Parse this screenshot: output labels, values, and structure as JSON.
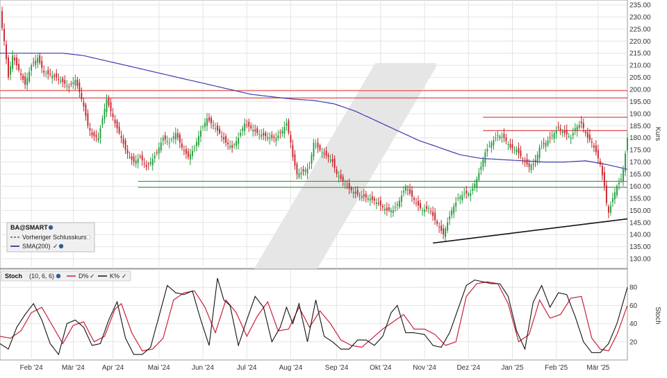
{
  "chart_data": [
    {
      "type": "candlestick",
      "title": "",
      "ylabel": "Kurs",
      "ylim": [
        126,
        237
      ],
      "yticks": [
        130,
        135,
        140,
        145,
        150,
        155,
        160,
        165,
        170,
        175,
        180,
        185,
        190,
        195,
        200,
        205,
        210,
        215,
        220,
        225,
        230,
        235
      ],
      "ytick_labels": [
        "130.00",
        "135.00",
        "140.00",
        "145.00",
        "150.00",
        "155.00",
        "160.00",
        "165.00",
        "170.00",
        "175.00",
        "180.00",
        "185.00",
        "190.00",
        "195.00",
        "200.00",
        "205.00",
        "210.00",
        "215.00",
        "220.00",
        "225.00",
        "230.00",
        "235.00"
      ],
      "month_labels": [
        "Feb '24",
        "Mär '24",
        "Apr '24",
        "Mai '24",
        "Jun '24",
        "Jul '24",
        "Aug '24",
        "Sep '24",
        "Okt '24",
        "Nov '24",
        "Dez '24",
        "Jan '25",
        "Feb '25",
        "Mär '25"
      ],
      "x_range": [
        0,
        300
      ],
      "month_positions": [
        15,
        35,
        54,
        76,
        97,
        118,
        139,
        161,
        182,
        203,
        224,
        245,
        266,
        286
      ],
      "close_anchors": [
        [
          0,
          231
        ],
        [
          2,
          220
        ],
        [
          4,
          205
        ],
        [
          6,
          214
        ],
        [
          9,
          208
        ],
        [
          12,
          202
        ],
        [
          15,
          210
        ],
        [
          18,
          213
        ],
        [
          21,
          207
        ],
        [
          24,
          206
        ],
        [
          27,
          205
        ],
        [
          30,
          203
        ],
        [
          33,
          201
        ],
        [
          36,
          204
        ],
        [
          38,
          199
        ],
        [
          40,
          193
        ],
        [
          42,
          185
        ],
        [
          44,
          181
        ],
        [
          47,
          180
        ],
        [
          49,
          188
        ],
        [
          51,
          196
        ],
        [
          53,
          191
        ],
        [
          55,
          186
        ],
        [
          58,
          180
        ],
        [
          60,
          175
        ],
        [
          62,
          172
        ],
        [
          64,
          170
        ],
        [
          67,
          172
        ],
        [
          70,
          168
        ],
        [
          72,
          170
        ],
        [
          75,
          174
        ],
        [
          78,
          180
        ],
        [
          81,
          178
        ],
        [
          84,
          182
        ],
        [
          87,
          176
        ],
        [
          90,
          172
        ],
        [
          93,
          176
        ],
        [
          96,
          183
        ],
        [
          99,
          188
        ],
        [
          102,
          185
        ],
        [
          105,
          182
        ],
        [
          108,
          178
        ],
        [
          111,
          176
        ],
        [
          114,
          180
        ],
        [
          117,
          186
        ],
        [
          120,
          184
        ],
        [
          123,
          182
        ],
        [
          126,
          181
        ],
        [
          129,
          180
        ],
        [
          132,
          180
        ],
        [
          135,
          183
        ],
        [
          137,
          186
        ],
        [
          139,
          178
        ],
        [
          140,
          172
        ],
        [
          142,
          165
        ],
        [
          145,
          166
        ],
        [
          148,
          168
        ],
        [
          150,
          178
        ],
        [
          152,
          176
        ],
        [
          154,
          174
        ],
        [
          157,
          172
        ],
        [
          159,
          170
        ],
        [
          161,
          165
        ],
        [
          164,
          162
        ],
        [
          167,
          159
        ],
        [
          170,
          157
        ],
        [
          173,
          156
        ],
        [
          176,
          155
        ],
        [
          179,
          154
        ],
        [
          182,
          152
        ],
        [
          185,
          150
        ],
        [
          188,
          150
        ],
        [
          191,
          154
        ],
        [
          194,
          160
        ],
        [
          196,
          157
        ],
        [
          199,
          153
        ],
        [
          202,
          150
        ],
        [
          205,
          151
        ],
        [
          208,
          146
        ],
        [
          210,
          143
        ],
        [
          212,
          140
        ],
        [
          214,
          145
        ],
        [
          216,
          150
        ],
        [
          219,
          155
        ],
        [
          222,
          157
        ],
        [
          225,
          157
        ],
        [
          228,
          163
        ],
        [
          230,
          168
        ],
        [
          232,
          174
        ],
        [
          235,
          178
        ],
        [
          238,
          181
        ],
        [
          241,
          180
        ],
        [
          244,
          176
        ],
        [
          247,
          175
        ],
        [
          250,
          171
        ],
        [
          253,
          168
        ],
        [
          256,
          170
        ],
        [
          258,
          176
        ],
        [
          261,
          178
        ],
        [
          264,
          181
        ],
        [
          267,
          184
        ],
        [
          270,
          182
        ],
        [
          273,
          180
        ],
        [
          275,
          184
        ],
        [
          278,
          186
        ],
        [
          281,
          180
        ],
        [
          283,
          178
        ],
        [
          285,
          174
        ],
        [
          287,
          169
        ],
        [
          289,
          160
        ],
        [
          290,
          153
        ],
        [
          291,
          149
        ],
        [
          293,
          155
        ],
        [
          295,
          160
        ],
        [
          297,
          163
        ],
        [
          298,
          167
        ],
        [
          300,
          180
        ]
      ],
      "sma_anchors": [
        [
          0,
          215
        ],
        [
          8,
          215
        ],
        [
          30,
          215
        ],
        [
          40,
          214
        ],
        [
          50,
          212
        ],
        [
          60,
          210
        ],
        [
          70,
          208
        ],
        [
          80,
          206
        ],
        [
          90,
          204
        ],
        [
          100,
          202
        ],
        [
          110,
          200
        ],
        [
          120,
          198
        ],
        [
          130,
          197
        ],
        [
          140,
          196
        ],
        [
          150,
          195.5
        ],
        [
          160,
          194
        ],
        [
          170,
          191
        ],
        [
          180,
          187
        ],
        [
          190,
          183
        ],
        [
          200,
          179
        ],
        [
          210,
          176
        ],
        [
          220,
          173
        ],
        [
          230,
          171.5
        ],
        [
          240,
          171
        ],
        [
          250,
          170.5
        ],
        [
          260,
          170
        ],
        [
          270,
          170
        ],
        [
          280,
          170.5
        ],
        [
          290,
          169
        ],
        [
          300,
          167
        ]
      ],
      "resistance_lines": [
        199.5,
        196.5
      ],
      "short_resistance_lines": [
        188.5,
        183
      ],
      "support_lines": [
        162,
        159.5
      ],
      "trendline": [
        [
          207,
          136.5
        ],
        [
          300,
          146.5
        ]
      ],
      "legend": {
        "symbol": "BA@SMART",
        "items": [
          {
            "label": "Vorheriger Schlusskurs",
            "color": "#444444",
            "style": "dashed"
          },
          {
            "label": "SMA(200)",
            "color": "#1a1a9c",
            "style": "solid"
          }
        ]
      },
      "colors": {
        "up": "#1f9c3a",
        "down": "#c8202a",
        "sma": "#3b3bb0",
        "resistance": "#e03030",
        "support": "#2aa02a",
        "trend": "#111111"
      }
    },
    {
      "type": "line",
      "title": "Stoch",
      "params": "(10, 6, 6)",
      "ylabel": "Stoch",
      "ylim": [
        0,
        100
      ],
      "yticks": [
        20,
        40,
        60,
        80
      ],
      "series": [
        {
          "name": "D%",
          "color": "#c8203a",
          "anchors": [
            [
              0,
              26
            ],
            [
              5,
              24
            ],
            [
              10,
              32
            ],
            [
              15,
              52
            ],
            [
              20,
              58
            ],
            [
              25,
              38
            ],
            [
              30,
              18
            ],
            [
              35,
              38
            ],
            [
              40,
              42
            ],
            [
              45,
              20
            ],
            [
              50,
              26
            ],
            [
              55,
              56
            ],
            [
              58,
              62
            ],
            [
              63,
              30
            ],
            [
              68,
              10
            ],
            [
              73,
              12
            ],
            [
              78,
              24
            ],
            [
              83,
              66
            ],
            [
              88,
              74
            ],
            [
              93,
              76
            ],
            [
              98,
              58
            ],
            [
              103,
              30
            ],
            [
              108,
              66
            ],
            [
              113,
              52
            ],
            [
              118,
              26
            ],
            [
              123,
              48
            ],
            [
              128,
              64
            ],
            [
              133,
              32
            ],
            [
              138,
              34
            ],
            [
              143,
              58
            ],
            [
              148,
              36
            ],
            [
              153,
              54
            ],
            [
              158,
              40
            ],
            [
              163,
              22
            ],
            [
              168,
              16
            ],
            [
              173,
              14
            ],
            [
              178,
              24
            ],
            [
              183,
              34
            ],
            [
              188,
              42
            ],
            [
              193,
              50
            ],
            [
              198,
              34
            ],
            [
              203,
              34
            ],
            [
              208,
              28
            ],
            [
              213,
              16
            ],
            [
              218,
              20
            ],
            [
              223,
              70
            ],
            [
              228,
              84
            ],
            [
              233,
              86
            ],
            [
              238,
              84
            ],
            [
              243,
              62
            ],
            [
              248,
              20
            ],
            [
              253,
              28
            ],
            [
              258,
              66
            ],
            [
              263,
              46
            ],
            [
              268,
              50
            ],
            [
              273,
              68
            ],
            [
              278,
              70
            ],
            [
              283,
              24
            ],
            [
              287,
              12
            ],
            [
              291,
              10
            ],
            [
              295,
              28
            ],
            [
              300,
              60
            ]
          ]
        },
        {
          "name": "K%",
          "color": "#111111",
          "anchors": [
            [
              0,
              18
            ],
            [
              4,
              12
            ],
            [
              8,
              36
            ],
            [
              12,
              50
            ],
            [
              16,
              62
            ],
            [
              20,
              44
            ],
            [
              24,
              18
            ],
            [
              28,
              6
            ],
            [
              32,
              40
            ],
            [
              36,
              44
            ],
            [
              40,
              36
            ],
            [
              44,
              16
            ],
            [
              48,
              18
            ],
            [
              52,
              44
            ],
            [
              56,
              64
            ],
            [
              60,
              24
            ],
            [
              64,
              6
            ],
            [
              68,
              6
            ],
            [
              72,
              14
            ],
            [
              76,
              48
            ],
            [
              80,
              82
            ],
            [
              84,
              74
            ],
            [
              88,
              72
            ],
            [
              92,
              76
            ],
            [
              96,
              44
            ],
            [
              100,
              16
            ],
            [
              104,
              90
            ],
            [
              107,
              66
            ],
            [
              110,
              60
            ],
            [
              114,
              16
            ],
            [
              118,
              44
            ],
            [
              122,
              70
            ],
            [
              126,
              58
            ],
            [
              130,
              20
            ],
            [
              134,
              36
            ],
            [
              137,
              58
            ],
            [
              140,
              40
            ],
            [
              143,
              62
            ],
            [
              147,
              20
            ],
            [
              151,
              66
            ],
            [
              155,
              26
            ],
            [
              159,
              20
            ],
            [
              163,
              12
            ],
            [
              167,
              12
            ],
            [
              171,
              22
            ],
            [
              175,
              22
            ],
            [
              179,
              16
            ],
            [
              183,
              26
            ],
            [
              187,
              52
            ],
            [
              190,
              60
            ],
            [
              194,
              30
            ],
            [
              198,
              30
            ],
            [
              203,
              28
            ],
            [
              207,
              16
            ],
            [
              211,
              14
            ],
            [
              215,
              30
            ],
            [
              219,
              56
            ],
            [
              223,
              82
            ],
            [
              227,
              88
            ],
            [
              231,
              86
            ],
            [
              235,
              84
            ],
            [
              239,
              84
            ],
            [
              243,
              70
            ],
            [
              247,
              32
            ],
            [
              251,
              12
            ],
            [
              255,
              64
            ],
            [
              259,
              82
            ],
            [
              263,
              58
            ],
            [
              267,
              74
            ],
            [
              271,
              72
            ],
            [
              275,
              48
            ],
            [
              279,
              20
            ],
            [
              283,
              8
            ],
            [
              287,
              8
            ],
            [
              291,
              18
            ],
            [
              295,
              40
            ],
            [
              300,
              80
            ]
          ]
        }
      ]
    }
  ]
}
